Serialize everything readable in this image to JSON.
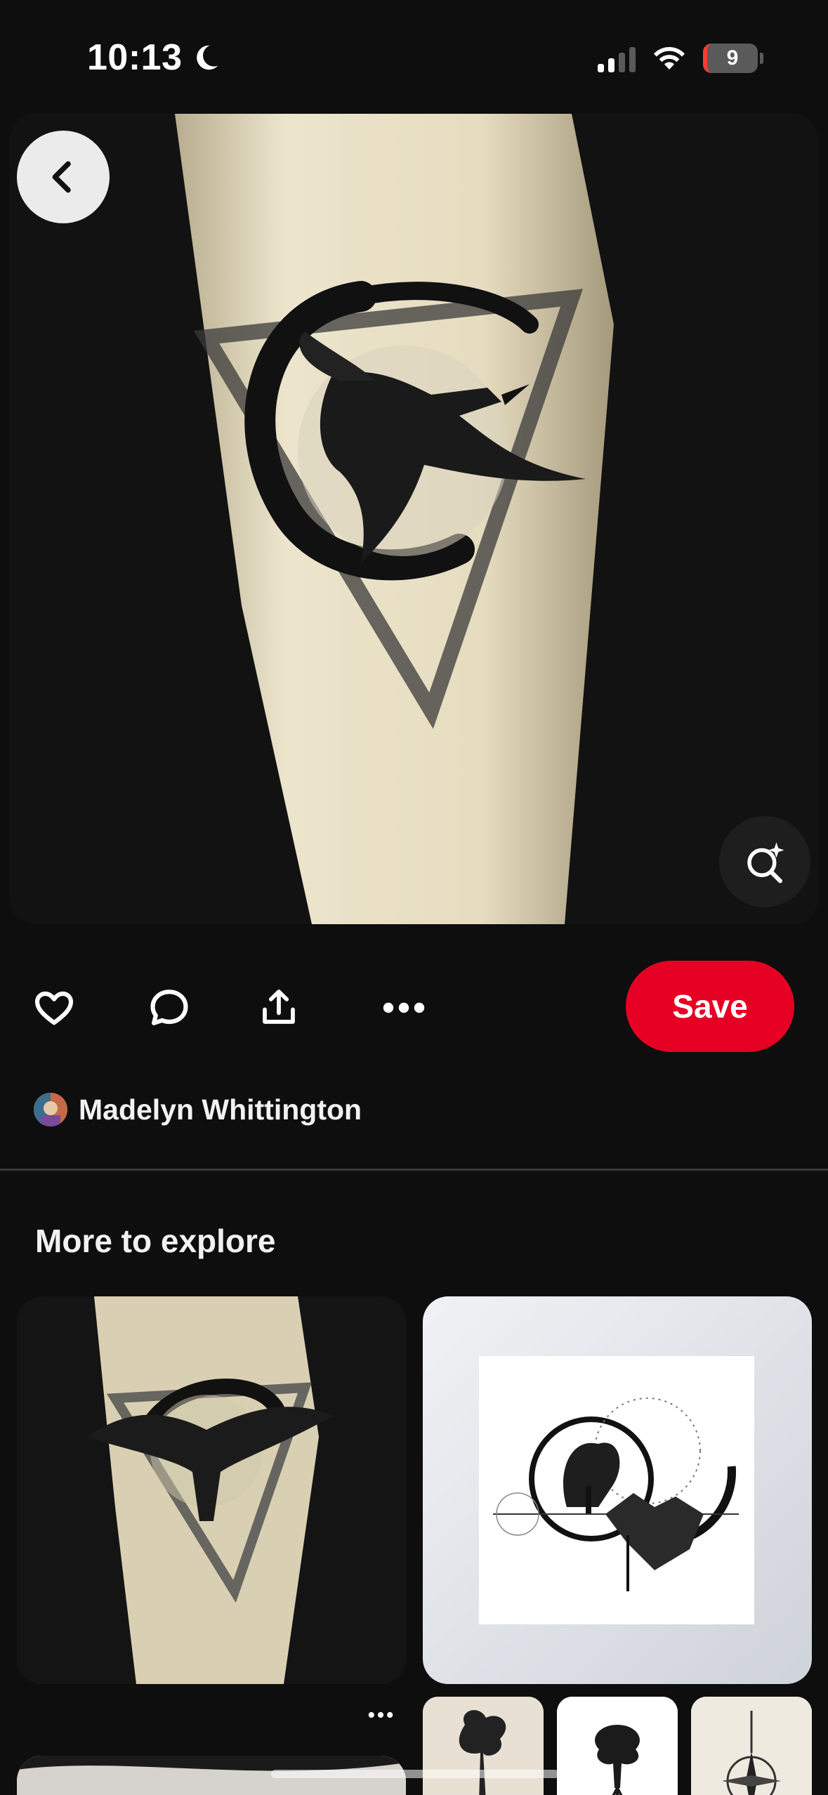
{
  "status_bar": {
    "time": "10:13",
    "battery_level": "9",
    "icons": [
      "moon-icon",
      "cellular-signal-icon",
      "wifi-icon",
      "battery-icon"
    ],
    "battery_color": "#ff3b30"
  },
  "pin": {
    "image_icon": "crow-tattoo-image",
    "back_icon": "chevron-left-icon",
    "visual_search_icon": "lens-sparkle-icon"
  },
  "actions": {
    "icons": [
      "heart-icon",
      "comment-icon",
      "share-icon",
      "more-icon"
    ],
    "save_label": "Save",
    "save_color": "#e60023"
  },
  "creator": {
    "name": "Madelyn Whittington"
  },
  "explore": {
    "title": "More to explore",
    "pins": [
      {
        "image": "crow-triangle-tattoo-image"
      },
      {
        "image": "tree-circle-art-image"
      }
    ],
    "board_thumbs": [
      "tree-silhouette-image",
      "tree-roots-image",
      "compass-tattoo-image"
    ]
  }
}
